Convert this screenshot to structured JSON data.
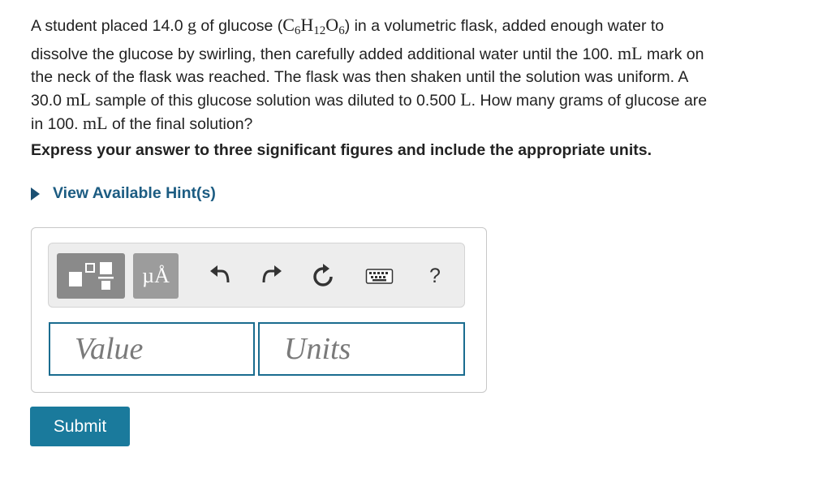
{
  "question": {
    "l1_a": "A student placed 14.0 ",
    "l1_g": "g",
    "l1_b": " of glucose (",
    "f_c": "C",
    "f_c_sub": "6",
    "f_h": "H",
    "f_h_sub": "12",
    "f_o": "O",
    "f_o_sub": "6",
    "l1_c": ") in a volumetric flask, added enough water to",
    "l2_a": "dissolve the glucose by swirling, then carefully added additional water until the 100. ",
    "l2_ml": "mL",
    "l2_b": " mark on",
    "l3": "the neck of the flask was reached. The flask was then shaken until the solution was uniform. A",
    "l4_a": "30.0 ",
    "l4_ml": "mL",
    "l4_b": " sample of this glucose solution was diluted to 0.500 ",
    "l4_l": "L",
    "l4_c": ". How many grams of glucose are",
    "l5_a": "in 100. ",
    "l5_ml": "mL",
    "l5_b": " of the final solution?"
  },
  "instruction": "Express your answer to three significant figures and include the appropriate units.",
  "hint": {
    "label": "View Available Hint(s)"
  },
  "toolbar": {
    "units_label": "µÅ",
    "help_label": "?",
    "icons": {
      "templates": "templates-icon",
      "undo": "undo-icon",
      "redo": "redo-icon",
      "reset": "reset-icon",
      "keyboard": "keyboard-icon"
    }
  },
  "inputs": {
    "value_placeholder": "Value",
    "units_placeholder": "Units"
  },
  "submit_label": "Submit",
  "colors": {
    "accent": "#1a7a9c",
    "hint_text": "#1c5c82",
    "field_border": "#1a6c8f",
    "toolbar_button": "#8a8a8a"
  }
}
